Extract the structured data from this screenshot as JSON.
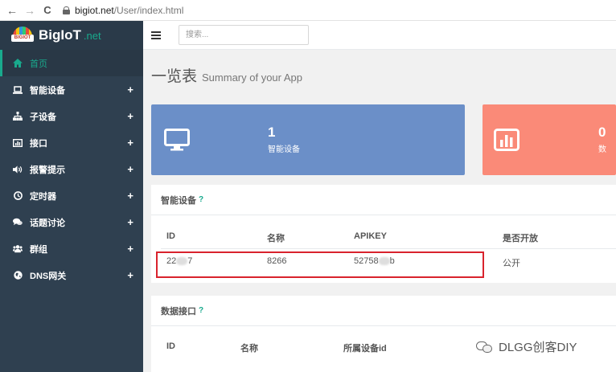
{
  "browser": {
    "back": "←",
    "forward": "→",
    "reload": "C",
    "url_host": "bigiot.net",
    "url_path": "/User/index.html"
  },
  "brand": {
    "logo_text": "BIGIOT",
    "name": "BigIoT",
    "suffix": ".net"
  },
  "sidebar": {
    "items": [
      {
        "label": "首页",
        "icon": "home-icon",
        "expandable": false,
        "active": true
      },
      {
        "label": "智能设备",
        "icon": "laptop-icon",
        "expandable": true
      },
      {
        "label": "子设备",
        "icon": "sitemap-icon",
        "expandable": true
      },
      {
        "label": "接口",
        "icon": "chart-icon",
        "expandable": true
      },
      {
        "label": "报警提示",
        "icon": "volume-icon",
        "expandable": true
      },
      {
        "label": "定时器",
        "icon": "clock-icon",
        "expandable": true
      },
      {
        "label": "话题讨论",
        "icon": "comments-icon",
        "expandable": true
      },
      {
        "label": "群组",
        "icon": "users-icon",
        "expandable": true
      },
      {
        "label": "DNS网关",
        "icon": "globe-icon",
        "expandable": true
      }
    ],
    "plus": "+"
  },
  "topbar": {
    "search_placeholder": "搜索..."
  },
  "heading": {
    "title": "一览表",
    "subtitle": "Summary of your App"
  },
  "cards": [
    {
      "count": "1",
      "label": "智能设备",
      "icon": "monitor-icon",
      "color": "#6b8fc8"
    },
    {
      "count": "0",
      "label": "数",
      "icon": "bar-chart-icon",
      "color": "#fa8a78"
    }
  ],
  "devices_panel": {
    "title": "智能设备",
    "help": "?",
    "headers": [
      "ID",
      "名称",
      "APIKEY",
      "是否开放"
    ],
    "rows": [
      {
        "id_start": "22",
        "id_end": "7",
        "name": "8266",
        "apikey_start": "52758",
        "apikey_end": "b",
        "open": "公开"
      }
    ]
  },
  "api_panel": {
    "title": "数据接口",
    "help": "?",
    "headers": [
      "ID",
      "名称",
      "所属设备id"
    ]
  },
  "watermark": {
    "text": "DLGG创客DIY"
  },
  "colors": {
    "sidebar": "#2f4050",
    "accent": "#19aa8d",
    "card_blue": "#6b8fc8",
    "card_red": "#fa8a78",
    "highlight": "#d9232d"
  }
}
